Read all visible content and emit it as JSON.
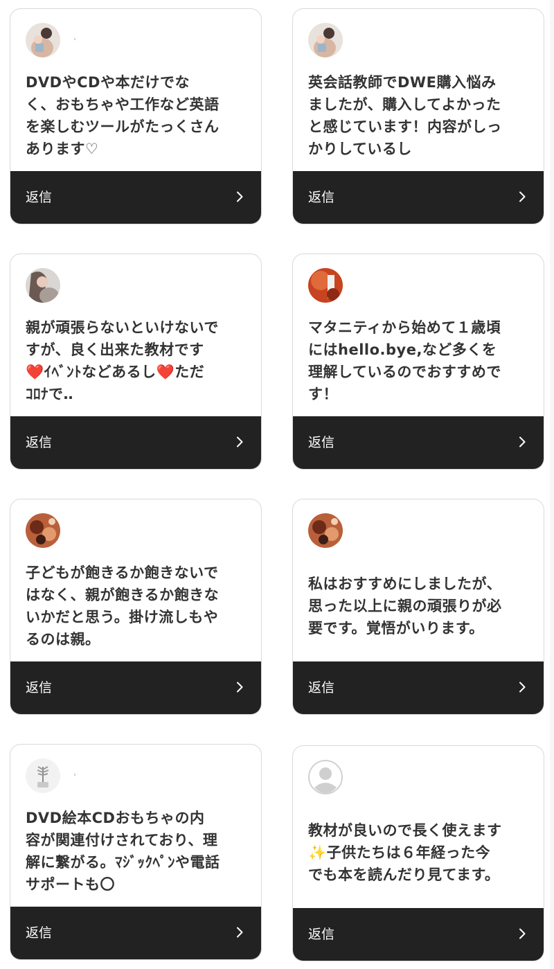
{
  "cards": [
    {
      "text": "DVDやCDや本だけでな\nく、おもちゃや工作など英語\nを楽しむツールがたっくさん\nあります♡",
      "reply_label": "返信",
      "avatar": "photo-avatar-mother-child-icon"
    },
    {
      "text": "英会話教師でDWE購入悩み\nましたが、購入してよかった\nと感じています！内容がしっ\nかりしているし",
      "reply_label": "返信",
      "avatar": "photo-avatar-mother-child-icon"
    },
    {
      "text": "親が頑張らないといけないで\nすが、良く出来た教材です\n❤️ｲﾍﾞﾝﾄなどあるし❤️ただ\nｺﾛﾅで‥",
      "reply_label": "返信",
      "avatar": "photo-avatar-woman-icon"
    },
    {
      "text": "マタニティから始めて１歳頃\nにはhello.bye,など多くを\n理解しているのでおすすめで\nす！",
      "reply_label": "返信",
      "avatar": "photo-avatar-orange-icon"
    },
    {
      "text": "子どもが飽きるか飽きないで\nはなく、親が飽きるか飽きな\nいかだと思う。掛け流しもや\nるのは親。",
      "reply_label": "返信",
      "avatar": "photo-avatar-food-icon"
    },
    {
      "text": "私はおすすめにしましたが、\n思った以上に親の頑張りが必\n要です。覚悟がいります。",
      "reply_label": "返信",
      "avatar": "photo-avatar-food-icon"
    },
    {
      "text": "DVD絵本CDおもちゃの内\n容が関連付けされており、理\n解に繋がる。ﾏｼﾞｯｸﾍﾟﾝや電話\nサポートも〇",
      "reply_label": "返信",
      "avatar": "photo-avatar-plant-icon"
    },
    {
      "text": "教材が良いので長く使えます\n✨子供たちは６年経った今\nでも本を読んだり見てます。",
      "reply_label": "返信",
      "avatar": "default-user-avatar-icon"
    }
  ]
}
